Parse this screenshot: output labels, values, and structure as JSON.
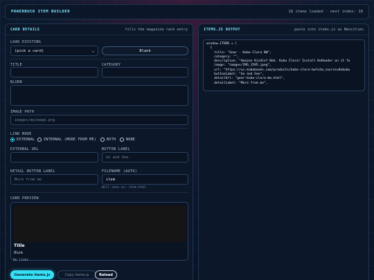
{
  "topbar": {
    "title": "POWERBUCK ITEM BUILDER",
    "status": "18 items loaded · next index: 18"
  },
  "card_details": {
    "heading": "CARD DETAILS",
    "subheading": "fills the magazine rack entry",
    "load_existing_label": "LOAD EXISTING",
    "load_existing_value": "(pick a card)",
    "blank_button": "Blank",
    "title_label": "TITLE",
    "category_label": "CATEGORY",
    "blurb_label": "BLURB",
    "image_path_label": "IMAGE PATH",
    "image_path_placeholder": "images/myimage.png",
    "link_mode_label": "LINK MODE",
    "link_modes": [
      "EXTERNAL",
      "INTERNAL (MORE FROM ME)",
      "BOTH",
      "NONE"
    ],
    "link_mode_selected": "EXTERNAL",
    "external_url_label": "EXTERNAL URL",
    "button_label_label": "BUTTON LABEL",
    "button_label_placeholder": "Go and See",
    "detail_button_label_label": "DETAIL BUTTON LABEL",
    "detail_button_label_placeholder": "More from me",
    "filename_label": "FILENAME (AUTO)",
    "filename_value": "item",
    "filename_hint": "Will save as: item.html",
    "preview_label": "CARD PREVIEW",
    "preview_title": "Title",
    "preview_blurb": "Blurb",
    "preview_links": "No links",
    "generate_button": "Generate items.js",
    "copy_button": "Copy items.js",
    "reload_button": "Reload"
  },
  "items_output": {
    "heading": "ITEMS.JS OUTPUT",
    "subheading": "paste into items.js as Neocities",
    "code": "window.ITEMS = [\n  {\n    title: \"Gear - Kobo Clara BW\",\n    category: \"\",\n    description: \"Amazon Kindle? Nah. Kobo Clara! Install KoReader on it fo\n    image: \"images/IMG_1595.jpeg\",\n    url: \"https://us.kobobooks.com/products/kobo-clara-bw?utm_source=Kobo&u\n    buttonLabel: \"Go and See\",\n    detailUrl: \"gear-kobo-clara-bw.html\",\n    detailLabel: \"More from me\","
  },
  "colors": {
    "accent": "#38e0f5",
    "heading": "#7fe7ff",
    "background": "#0a1424"
  }
}
